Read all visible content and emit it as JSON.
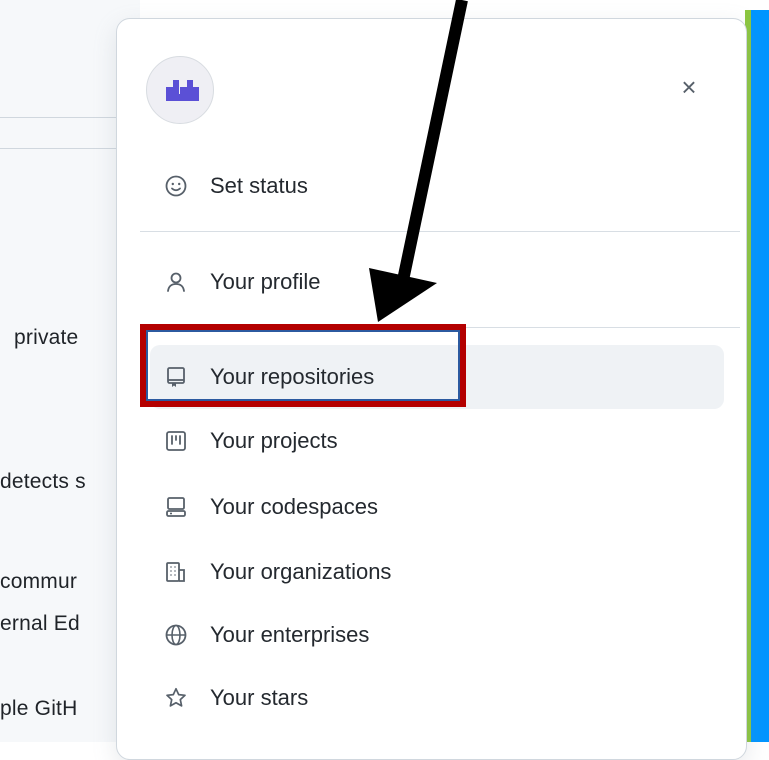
{
  "background": {
    "fragments": [
      "private",
      "detects s",
      "commur",
      "ernal Ed",
      "ple GitH"
    ]
  },
  "menu": {
    "avatar": "user-avatar",
    "close_icon": "×",
    "set_status": "Set status",
    "items": [
      {
        "label": "Your profile",
        "icon": "person-icon"
      },
      {
        "label": "Your repositories",
        "icon": "repo-icon"
      },
      {
        "label": "Your projects",
        "icon": "project-icon"
      },
      {
        "label": "Your codespaces",
        "icon": "codespaces-icon"
      },
      {
        "label": "Your organizations",
        "icon": "organization-icon"
      },
      {
        "label": "Your enterprises",
        "icon": "globe-icon"
      },
      {
        "label": "Your stars",
        "icon": "star-icon"
      }
    ]
  },
  "colors": {
    "highlight_red": "#b40000",
    "highlight_blue": "#2c5aa0",
    "strip_green": "#8cc63f",
    "strip_blue": "#0095ff"
  }
}
